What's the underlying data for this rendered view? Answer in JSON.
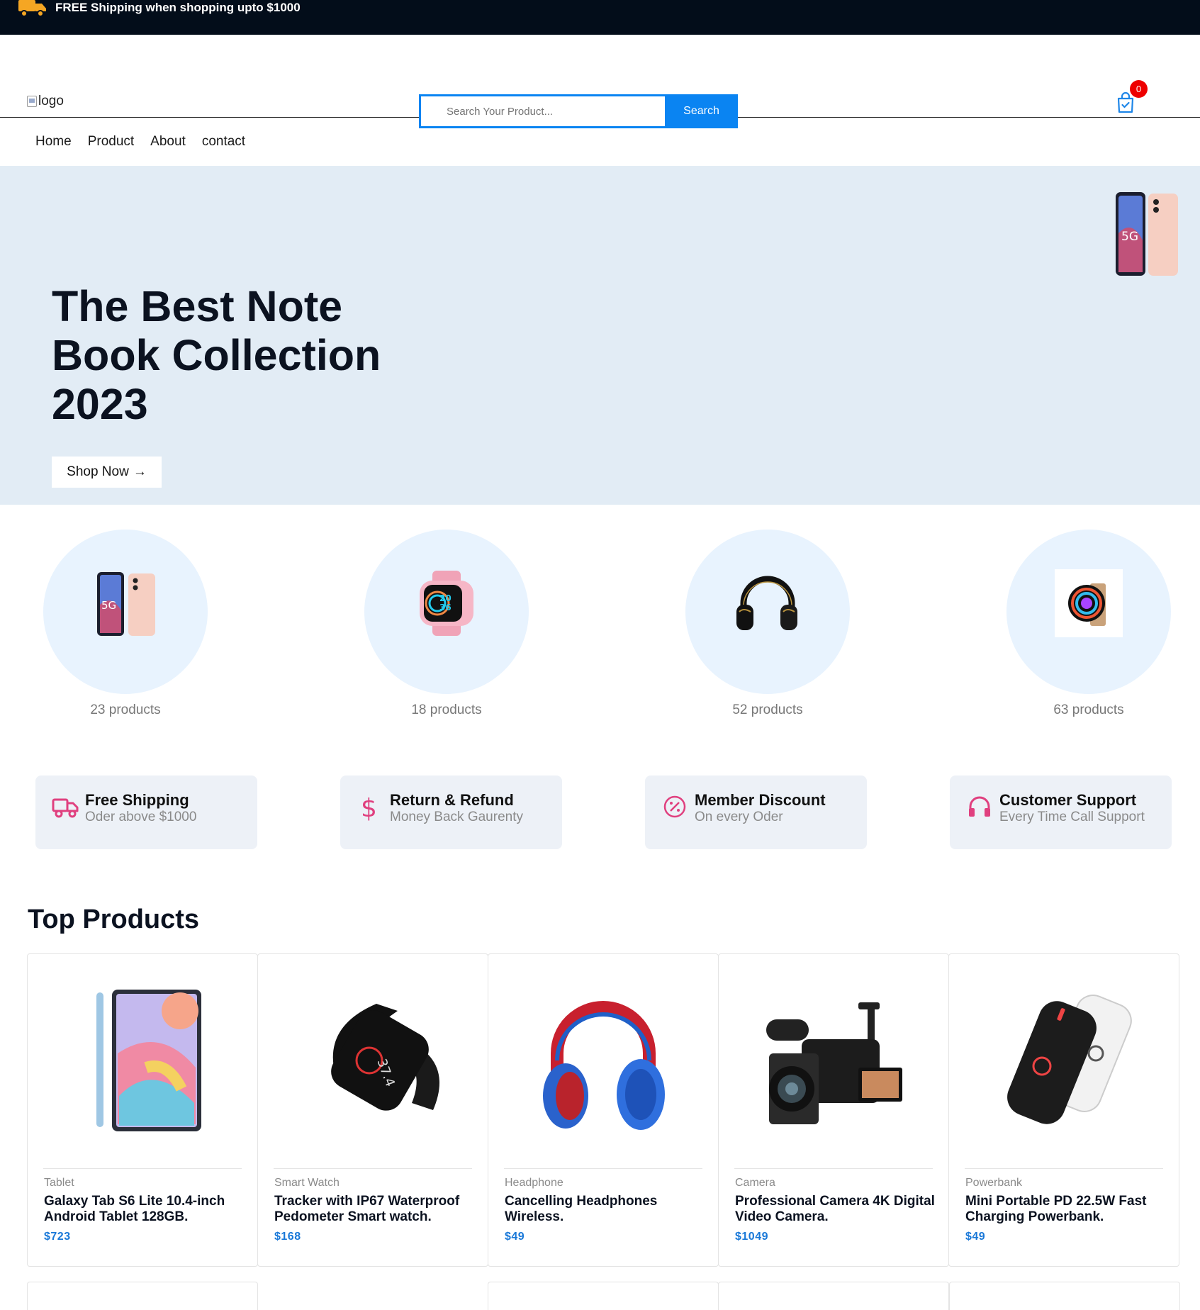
{
  "topbar": {
    "message": "FREE Shipping when shopping upto $1000",
    "icon": "truck-icon",
    "icon_color": "#f5a623"
  },
  "header": {
    "logo_alt": "logo",
    "search": {
      "placeholder": "Search Your Product...",
      "button": "Search"
    },
    "cart": {
      "count": "0",
      "icon": "shopping-bag-icon"
    }
  },
  "nav": {
    "items": [
      "Home",
      "Product",
      "About",
      "contact"
    ]
  },
  "hero": {
    "title": "The Best Note Book Collection 2023",
    "button": "Shop Now",
    "button_arrow": "→"
  },
  "categories": [
    {
      "count": "23 products",
      "icon": "smartphone-icon"
    },
    {
      "count": "18 products",
      "icon": "smartwatch-icon"
    },
    {
      "count": "52 products",
      "icon": "headphones-icon"
    },
    {
      "count": "63 products",
      "icon": "cpu-cooler-icon"
    }
  ],
  "features": [
    {
      "title": "Free Shipping",
      "subtitle": "Oder above $1000",
      "icon": "truck-icon"
    },
    {
      "title": "Return & Refund",
      "subtitle": "Money Back Gaurenty",
      "icon": "dollar-icon"
    },
    {
      "title": "Member Discount",
      "subtitle": "On every Oder",
      "icon": "discount-icon"
    },
    {
      "title": "Customer Support",
      "subtitle": "Every Time Call Support",
      "icon": "headset-icon"
    }
  ],
  "top_products": {
    "title": "Top Products",
    "items": [
      {
        "category": "Tablet",
        "name": "Galaxy Tab S6 Lite 10.4-inch Android Tablet 128GB.",
        "price": "$723"
      },
      {
        "category": "Smart Watch",
        "name": "Tracker with IP67 Waterproof Pedometer Smart watch.",
        "price": "$168"
      },
      {
        "category": "Headphone",
        "name": "Cancelling Headphones Wireless.",
        "price": "$49"
      },
      {
        "category": "Camera",
        "name": "Professional Camera 4K Digital Video Camera.",
        "price": "$1049"
      },
      {
        "category": "Powerbank",
        "name": "Mini Portable PD 22.5W Fast Charging Powerbank.",
        "price": "$49"
      }
    ]
  },
  "colors": {
    "accent": "#0a84f2",
    "price": "#1978d8",
    "feature_icon": "#e0407f",
    "badge": "#ee0000",
    "hero_bg": "#e2ecf5"
  }
}
